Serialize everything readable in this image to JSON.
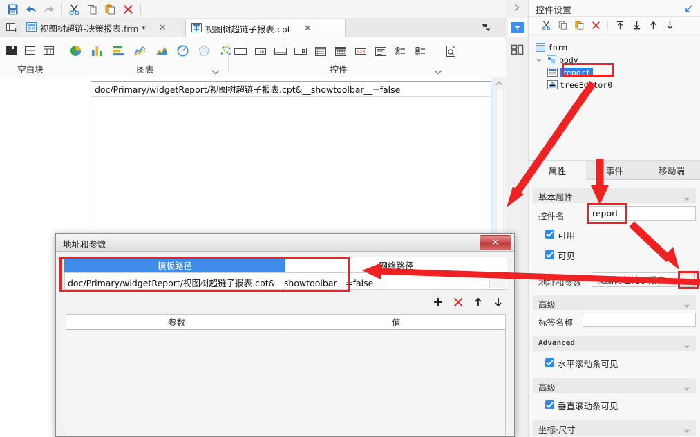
{
  "quick_toolbar": [
    {
      "name": "save-icon",
      "label": "保存"
    },
    {
      "name": "undo-icon",
      "label": "撤销"
    },
    {
      "name": "redo-icon",
      "label": "恢复"
    },
    {
      "name": "cut-icon",
      "label": "剪切"
    },
    {
      "name": "copy-icon",
      "label": "复制"
    },
    {
      "name": "paste-icon",
      "label": "粘贴"
    },
    {
      "name": "delete-icon",
      "label": "删除"
    }
  ],
  "tabs": [
    {
      "label": "视图树超链-决策报表.frm *",
      "active": false,
      "close": "✕",
      "icon": "frm-icon"
    },
    {
      "label": "视图树超链子报表.cpt",
      "active": true,
      "close": "✕",
      "icon": "cpt-icon"
    }
  ],
  "ribbon": {
    "groups": [
      {
        "label": "空白块",
        "icons": [
          "blank-block-icon",
          "split-horizontal-icon",
          "split-grid-icon"
        ],
        "caret": false
      },
      {
        "label": "图表",
        "icons": [
          "pie-chart-icon",
          "bar-chart-icon",
          "hbar-chart-icon",
          "line-chart-icon",
          "area-chart-icon",
          "gauge-chart-icon",
          "radar-chart-icon",
          "scatter-chart-icon"
        ],
        "caret": true
      },
      {
        "label": "控件",
        "icons": [
          "textbox-icon",
          "label-icon",
          "textarea-icon",
          "combobox-icon",
          "listbox-icon",
          "date-icon",
          "number-icon",
          "richtext-icon",
          "radio-group-icon",
          "checkbox-group-icon",
          "preview-icon"
        ],
        "caret": true
      }
    ]
  },
  "canvas": {
    "report_url": "doc/Primary/widgetReport/视图树超链子报表.cpt&__showtoolbar__=false"
  },
  "right_rail": {
    "collapse": "collapse-arrow-icon",
    "buttons": [
      {
        "name": "widget-settings-icon",
        "selected": true
      },
      {
        "name": "layout-settings-icon",
        "selected": false
      }
    ]
  },
  "right_panel": {
    "title": "控件设置",
    "expand_icon": "expand-arrow-icon",
    "tree_toolbar": [
      {
        "name": "cut-icon"
      },
      {
        "name": "copy-icon"
      },
      {
        "name": "paste-icon"
      },
      {
        "name": "delete-icon"
      },
      {
        "name": "move-top-icon"
      },
      {
        "name": "move-bottom-icon"
      },
      {
        "name": "move-up-icon"
      },
      {
        "name": "move-down-icon"
      }
    ],
    "tree": [
      {
        "label": "form",
        "depth": 0,
        "icon": "form-node-icon",
        "selected": false,
        "expander": false
      },
      {
        "label": "body",
        "depth": 1,
        "icon": "body-node-icon",
        "selected": false,
        "expander": true
      },
      {
        "label": "report",
        "depth": 2,
        "icon": "report-node-icon",
        "selected": true,
        "expander": false
      },
      {
        "label": "treeEditor0",
        "depth": 2,
        "icon": "tree-editor-node-icon",
        "selected": false,
        "expander": false
      }
    ],
    "prop_tabs": [
      {
        "label": "属性",
        "active": true
      },
      {
        "label": "事件",
        "active": false
      },
      {
        "label": "移动端",
        "active": false
      }
    ],
    "sections": [
      {
        "title": "基本属性",
        "mono": false
      },
      {
        "title": "高级",
        "mono": false
      },
      {
        "title": "Advanced",
        "mono": true
      },
      {
        "title": "高级",
        "mono": false
      },
      {
        "title": "坐标·尺寸",
        "mono": false
      }
    ],
    "widget_name_label": "控件名",
    "widget_name_value": "report",
    "checkbox_enabled": "可用",
    "checkbox_visible": "可见",
    "address_label": "地址和参数",
    "address_value": "视图树超链子报表.cpt",
    "address_ellipsis": "...",
    "tag_name_label": "标签名称",
    "tag_name_value": "",
    "checkbox_hscroll": "水平滚动条可见",
    "checkbox_vscroll": "垂直滚动条可见"
  },
  "dialog": {
    "title": "地址和参数",
    "close_label": "✕",
    "path_tabs": [
      {
        "label": "模板路径",
        "selected": true
      },
      {
        "label": "网络路径",
        "selected": false
      }
    ],
    "path_value": "doc/Primary/widgetReport/视图树超链子报表.cpt&__showtoolbar__=false",
    "path_browse": "...",
    "tool_buttons": [
      {
        "name": "add-param-icon",
        "glyph": "+"
      },
      {
        "name": "remove-param-icon",
        "glyph": "✕"
      },
      {
        "name": "move-param-up-icon",
        "glyph": "↑"
      },
      {
        "name": "move-param-down-icon",
        "glyph": "↓"
      }
    ],
    "table": {
      "columns": [
        "参数",
        "值"
      ],
      "rows": []
    }
  },
  "annotations": {
    "highlight_color": "#ee2222",
    "boxes": [
      {
        "name": "report-tree-node-highlight"
      },
      {
        "name": "widget-name-field-highlight"
      },
      {
        "name": "address-ellipsis-highlight"
      },
      {
        "name": "dialog-template-path-highlight"
      }
    ],
    "arrows": [
      {
        "name": "arrow-tree-to-dialog"
      },
      {
        "name": "arrow-to-widget-name"
      },
      {
        "name": "arrow-to-ellipsis"
      },
      {
        "name": "arrow-ellipsis-to-dialog-path"
      }
    ]
  }
}
